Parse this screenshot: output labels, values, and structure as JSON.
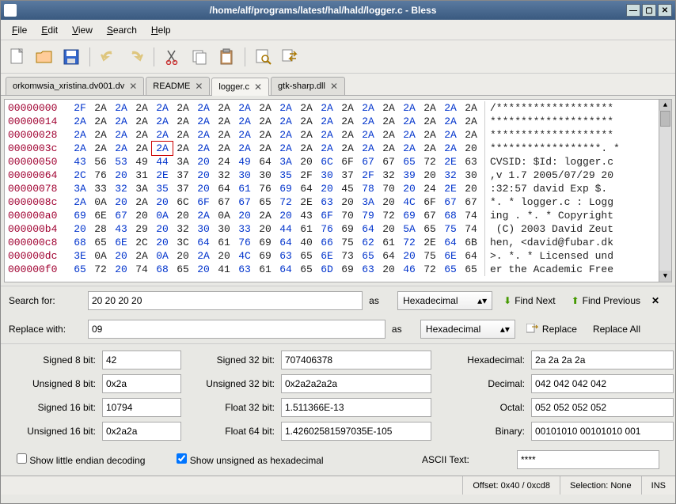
{
  "window": {
    "title": "/home/alf/programs/latest/hal/hald/logger.c - Bless"
  },
  "menu": {
    "file": "File",
    "edit": "Edit",
    "view": "View",
    "search": "Search",
    "help": "Help"
  },
  "tabs": [
    {
      "label": "orkomwsia_xristina.dv001.dv",
      "active": false
    },
    {
      "label": "README",
      "active": false
    },
    {
      "label": "logger.c",
      "active": true
    },
    {
      "label": "gtk-sharp.dll",
      "active": false
    }
  ],
  "hex": {
    "rows": [
      {
        "off": "00000000",
        "bytes": [
          "2F",
          "2A",
          "2A",
          "2A",
          "2A",
          "2A",
          "2A",
          "2A",
          "2A",
          "2A",
          "2A",
          "2A",
          "2A",
          "2A",
          "2A",
          "2A",
          "2A",
          "2A",
          "2A",
          "2A"
        ],
        "ascii": "/*******************"
      },
      {
        "off": "00000014",
        "bytes": [
          "2A",
          "2A",
          "2A",
          "2A",
          "2A",
          "2A",
          "2A",
          "2A",
          "2A",
          "2A",
          "2A",
          "2A",
          "2A",
          "2A",
          "2A",
          "2A",
          "2A",
          "2A",
          "2A",
          "2A"
        ],
        "ascii": "********************"
      },
      {
        "off": "00000028",
        "bytes": [
          "2A",
          "2A",
          "2A",
          "2A",
          "2A",
          "2A",
          "2A",
          "2A",
          "2A",
          "2A",
          "2A",
          "2A",
          "2A",
          "2A",
          "2A",
          "2A",
          "2A",
          "2A",
          "2A",
          "2A"
        ],
        "ascii": "********************"
      },
      {
        "off": "0000003c",
        "bytes": [
          "2A",
          "2A",
          "2A",
          "2A",
          "2A",
          "2A",
          "2A",
          "2A",
          "2A",
          "2A",
          "2A",
          "2A",
          "2A",
          "2A",
          "2A",
          "2A",
          "2A",
          "2A",
          "2A",
          "20"
        ],
        "ascii": "******************. *"
      },
      {
        "off": "00000050",
        "bytes": [
          "43",
          "56",
          "53",
          "49",
          "44",
          "3A",
          "20",
          "24",
          "49",
          "64",
          "3A",
          "20",
          "6C",
          "6F",
          "67",
          "67",
          "65",
          "72",
          "2E",
          "63"
        ],
        "ascii": "CVSID: $Id: logger.c"
      },
      {
        "off": "00000064",
        "bytes": [
          "2C",
          "76",
          "20",
          "31",
          "2E",
          "37",
          "20",
          "32",
          "30",
          "30",
          "35",
          "2F",
          "30",
          "37",
          "2F",
          "32",
          "39",
          "20",
          "32",
          "30"
        ],
        "ascii": ",v 1.7 2005/07/29 20"
      },
      {
        "off": "00000078",
        "bytes": [
          "3A",
          "33",
          "32",
          "3A",
          "35",
          "37",
          "20",
          "64",
          "61",
          "76",
          "69",
          "64",
          "20",
          "45",
          "78",
          "70",
          "20",
          "24",
          "2E",
          "20"
        ],
        "ascii": ":32:57 david Exp $. "
      },
      {
        "off": "0000008c",
        "bytes": [
          "2A",
          "0A",
          "20",
          "2A",
          "20",
          "6C",
          "6F",
          "67",
          "67",
          "65",
          "72",
          "2E",
          "63",
          "20",
          "3A",
          "20",
          "4C",
          "6F",
          "67",
          "67"
        ],
        "ascii": "*. * logger.c : Logg"
      },
      {
        "off": "000000a0",
        "bytes": [
          "69",
          "6E",
          "67",
          "20",
          "0A",
          "20",
          "2A",
          "0A",
          "20",
          "2A",
          "20",
          "43",
          "6F",
          "70",
          "79",
          "72",
          "69",
          "67",
          "68",
          "74"
        ],
        "ascii": "ing . *. * Copyright"
      },
      {
        "off": "000000b4",
        "bytes": [
          "20",
          "28",
          "43",
          "29",
          "20",
          "32",
          "30",
          "30",
          "33",
          "20",
          "44",
          "61",
          "76",
          "69",
          "64",
          "20",
          "5A",
          "65",
          "75",
          "74"
        ],
        "ascii": " (C) 2003 David Zeut"
      },
      {
        "off": "000000c8",
        "bytes": [
          "68",
          "65",
          "6E",
          "2C",
          "20",
          "3C",
          "64",
          "61",
          "76",
          "69",
          "64",
          "40",
          "66",
          "75",
          "62",
          "61",
          "72",
          "2E",
          "64",
          "6B"
        ],
        "ascii": "hen, <david@fubar.dk"
      },
      {
        "off": "000000dc",
        "bytes": [
          "3E",
          "0A",
          "20",
          "2A",
          "0A",
          "20",
          "2A",
          "20",
          "4C",
          "69",
          "63",
          "65",
          "6E",
          "73",
          "65",
          "64",
          "20",
          "75",
          "6E",
          "64"
        ],
        "ascii": ">. *. * Licensed und"
      },
      {
        "off": "000000f0",
        "bytes": [
          "65",
          "72",
          "20",
          "74",
          "68",
          "65",
          "20",
          "41",
          "63",
          "61",
          "64",
          "65",
          "6D",
          "69",
          "63",
          "20",
          "46",
          "72",
          "65",
          "65"
        ],
        "ascii": "er the Academic Free"
      }
    ],
    "cursor_row": 3,
    "cursor_col": 4
  },
  "search": {
    "for_label": "Search for:",
    "for_value": "20 20 20 20",
    "as": "as",
    "format": "Hexadecimal",
    "find_next": "Find Next",
    "find_prev": "Find Previous"
  },
  "replace": {
    "with_label": "Replace with:",
    "with_value": "09",
    "as": "as",
    "format": "Hexadecimal",
    "replace": "Replace",
    "replace_all": "Replace All"
  },
  "data": {
    "s8_l": "Signed 8 bit:",
    "s8": "42",
    "u8_l": "Unsigned 8 bit:",
    "u8": "0x2a",
    "s16_l": "Signed 16 bit:",
    "s16": "10794",
    "u16_l": "Unsigned 16 bit:",
    "u16": "0x2a2a",
    "s32_l": "Signed 32 bit:",
    "s32": "707406378",
    "u32_l": "Unsigned 32 bit:",
    "u32": "0x2a2a2a2a",
    "f32_l": "Float 32 bit:",
    "f32": "1.511366E-13",
    "f64_l": "Float 64 bit:",
    "f64": "1.42602581597035E-105",
    "hex_l": "Hexadecimal:",
    "hex": "2a 2a 2a 2a",
    "dec_l": "Decimal:",
    "dec": "042 042 042 042",
    "oct_l": "Octal:",
    "oct": "052 052 052 052",
    "bin_l": "Binary:",
    "bin": "00101010 00101010 001",
    "ascii_l": "ASCII Text:",
    "ascii": "****",
    "little_endian": "Show little endian decoding",
    "unsigned_hex": "Show unsigned as hexadecimal"
  },
  "status": {
    "offset": "Offset: 0x40 / 0xcd8",
    "selection": "Selection: None",
    "ins": "INS"
  }
}
